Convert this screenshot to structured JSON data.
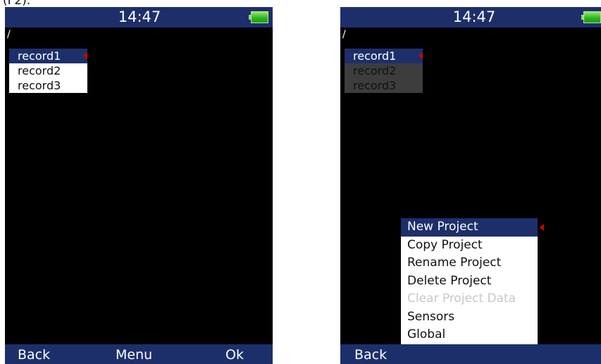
{
  "caption": "(F2).",
  "left_screen": {
    "status": {
      "time": "14:47",
      "battery_icon": "battery-full-icon"
    },
    "path": "/",
    "records": [
      {
        "label": "record1",
        "selected": true
      },
      {
        "label": "record2",
        "selected": false
      },
      {
        "label": "record3",
        "selected": false
      }
    ],
    "softkeys": {
      "back": "Back",
      "menu": "Menu",
      "ok": "Ok"
    }
  },
  "right_screen": {
    "status": {
      "time": "14:47",
      "battery_icon": "battery-full-icon"
    },
    "path": "/",
    "records": [
      {
        "label": "record1",
        "selected": true
      },
      {
        "label": "record2",
        "selected": false
      },
      {
        "label": "record3",
        "selected": false
      }
    ],
    "menu": {
      "items": [
        {
          "label": "New Project",
          "selected": true,
          "enabled": true
        },
        {
          "label": "Copy Project",
          "selected": false,
          "enabled": true
        },
        {
          "label": "Rename Project",
          "selected": false,
          "enabled": true
        },
        {
          "label": "Delete Project",
          "selected": false,
          "enabled": true
        },
        {
          "label": "Clear Project Data",
          "selected": false,
          "enabled": false
        },
        {
          "label": "Sensors",
          "selected": false,
          "enabled": true
        },
        {
          "label": "Global",
          "selected": false,
          "enabled": true
        }
      ]
    },
    "softkeys": {
      "back": "Back"
    }
  },
  "colors": {
    "bar_blue": "#1d2f6b",
    "selection_marker": "#d40000",
    "screen_background": "#000000",
    "disabled_text": "#c8c8c8"
  }
}
